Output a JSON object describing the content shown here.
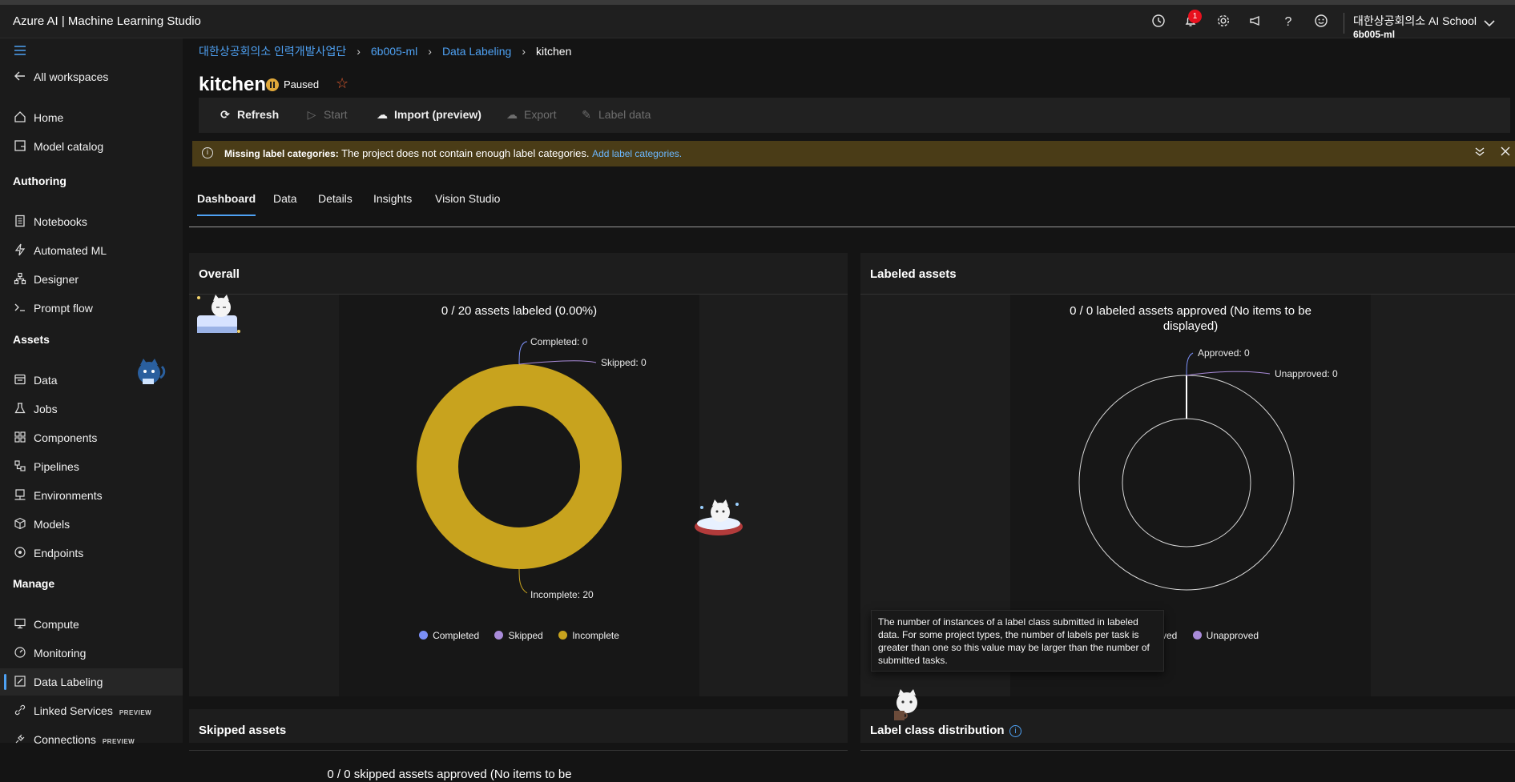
{
  "app": {
    "title": "Azure AI | Machine Learning Studio"
  },
  "topbar": {
    "notifications_count": "1",
    "account_name": "대한상공회의소 AI School",
    "workspace": "6b005-ml"
  },
  "sidebar": {
    "all_workspaces": "All workspaces",
    "home": "Home",
    "model_catalog": "Model catalog",
    "sections": {
      "authoring": "Authoring",
      "assets": "Assets",
      "manage": "Manage"
    },
    "authoring": [
      "Notebooks",
      "Automated ML",
      "Designer",
      "Prompt flow"
    ],
    "assets": [
      "Data",
      "Jobs",
      "Components",
      "Pipelines",
      "Environments",
      "Models",
      "Endpoints"
    ],
    "manage": [
      "Compute",
      "Monitoring",
      "Data Labeling",
      "Linked Services",
      "Connections"
    ],
    "preview_tag": "PREVIEW"
  },
  "breadcrumb": [
    "대한상공회의소 인력개발사업단",
    "6b005-ml",
    "Data Labeling",
    "kitchen"
  ],
  "project": {
    "name": "kitchen",
    "status": "Paused"
  },
  "toolbar": {
    "refresh": "Refresh",
    "start": "Start",
    "import": "Import (preview)",
    "export": "Export",
    "label_data": "Label data"
  },
  "alert": {
    "title": "Missing label categories:",
    "message": "The project does not contain enough label categories.",
    "link": "Add label categories."
  },
  "tabs": [
    "Dashboard",
    "Data",
    "Details",
    "Insights",
    "Vision Studio"
  ],
  "cards": {
    "overall": "Overall",
    "labeled_assets": "Labeled assets",
    "skipped_assets": "Skipped assets",
    "label_class_distribution": "Label class distribution"
  },
  "colors": {
    "completed": "#7b8ff7",
    "skipped": "#a98bd9",
    "incomplete": "#c8a31e",
    "accent": "#4ea1f3"
  },
  "chart_data": [
    {
      "type": "pie",
      "title": "0 / 20 assets labeled (0.00%)",
      "categories": [
        "Completed",
        "Skipped",
        "Incomplete"
      ],
      "values": [
        0,
        0,
        20
      ],
      "labels": [
        "Completed: 0",
        "Skipped: 0",
        "Incomplete: 20"
      ],
      "legend": [
        "Completed",
        "Skipped",
        "Incomplete"
      ],
      "legend_position": "bottom"
    },
    {
      "type": "pie",
      "title": "0 / 0 labeled assets approved (No items to be displayed)",
      "categories": [
        "Approved",
        "Unapproved"
      ],
      "values": [
        0,
        0
      ],
      "labels": [
        "Approved: 0",
        "Unapproved: 0"
      ],
      "legend": [
        "Approved",
        "Unapproved"
      ],
      "legend_position": "bottom"
    }
  ],
  "skipped_chart_title": "0 / 0 skipped assets approved (No items to be",
  "tooltip": "The number of instances of a label class submitted in labeled data. For some project types, the number of labels per task is greater than one so this value may be larger than the number of submitted tasks."
}
